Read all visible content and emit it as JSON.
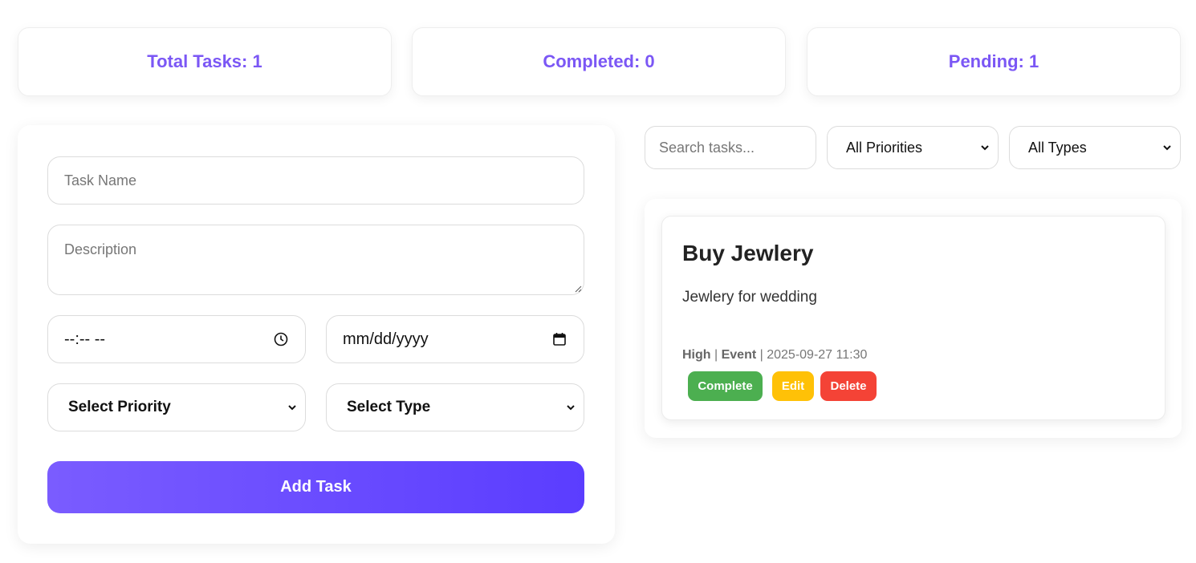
{
  "stats": {
    "total": "Total Tasks: 1",
    "completed": "Completed: 0",
    "pending": "Pending: 1"
  },
  "form": {
    "task_name_placeholder": "Task Name",
    "description_placeholder": "Description",
    "time_value": "--:-- --",
    "date_value": "mm/dd/yyyy",
    "priority_value": "Select Priority",
    "type_value": "Select Type",
    "submit_label": "Add Task"
  },
  "filters": {
    "search_placeholder": "Search tasks...",
    "priority_value": "All Priorities",
    "type_value": "All Types"
  },
  "tasks": [
    {
      "title": "Buy Jewlery",
      "description": "Jewlery for wedding",
      "priority": "High",
      "type": "Event",
      "datetime": "2025-09-27 11:30",
      "actions": {
        "complete": "Complete",
        "edit": "Edit",
        "delete": "Delete"
      }
    }
  ],
  "colors": {
    "accent": "#7b57f5",
    "complete": "#4caf50",
    "edit": "#ffc107",
    "delete": "#f44336"
  }
}
